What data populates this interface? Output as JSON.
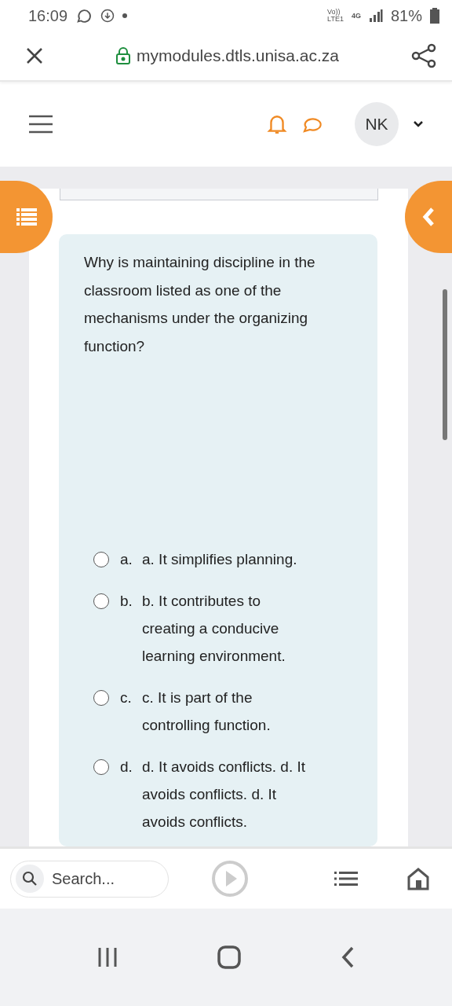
{
  "status_bar": {
    "time": "16:09",
    "network_top": "Vo))",
    "network_bottom": "LTE1",
    "data_type": "4G",
    "battery": "81%"
  },
  "browser": {
    "url": "mymodules.dtls.unisa.ac.za"
  },
  "header": {
    "avatar": "NK"
  },
  "question": {
    "text": "Why is maintaining discipline in the classroom listed as one of the mechanisms under the organizing function?",
    "options": [
      {
        "letter": "a.",
        "text": "a. It simplifies planning.",
        "selected": false
      },
      {
        "letter": "b.",
        "text": "b. It contributes to creating a conducive learning environment.",
        "selected": false
      },
      {
        "letter": "c.",
        "text": "c. It is part of the controlling function.",
        "selected": false
      },
      {
        "letter": "d.",
        "text": "d. It avoids conflicts. d. It avoids conflicts. d. It avoids conflicts.",
        "selected": false
      }
    ]
  },
  "toolbar": {
    "search_placeholder": "Search..."
  }
}
